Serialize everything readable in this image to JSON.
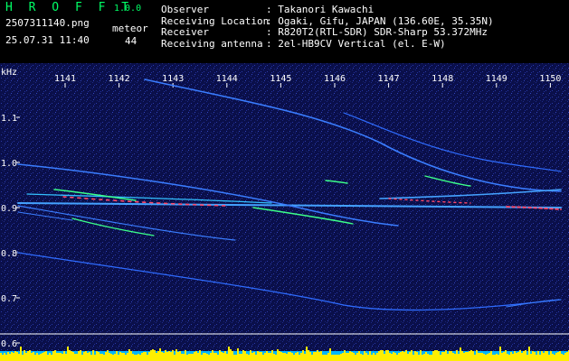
{
  "header": {
    "app_title": "H R O F F T",
    "version": "1.0.0",
    "filename": "2507311140.png",
    "timestamp": "25.07.31 11:40",
    "meteor_label": "meteor",
    "meteor_count": "44",
    "info": [
      {
        "label": "Observer",
        "value": ": Takanori Kawachi"
      },
      {
        "label": "Receiving Location",
        "value": ": Ogaki, Gifu, JAPAN (136.60E, 35.35N)"
      },
      {
        "label": "Receiver",
        "value": ": R820T2(RTL-SDR) SDR-Sharp 53.372MHz"
      },
      {
        "label": "Receiving antenna",
        "value": ": 2el-HB9CV Vertical (el. E-W)"
      }
    ]
  },
  "chart_data": {
    "type": "heatmap",
    "ylabel": "kHz",
    "y_ticks": [
      "1.1",
      "1.0",
      "0.9",
      "0.8",
      "0.7",
      "0.6"
    ],
    "x_ticks": [
      "1141",
      "1142",
      "1143",
      "1144",
      "1145",
      "1146",
      "1147",
      "1148",
      "1149",
      "1150"
    ],
    "background_color": "#0a0f4a",
    "trace_color": "#3a7dff"
  }
}
